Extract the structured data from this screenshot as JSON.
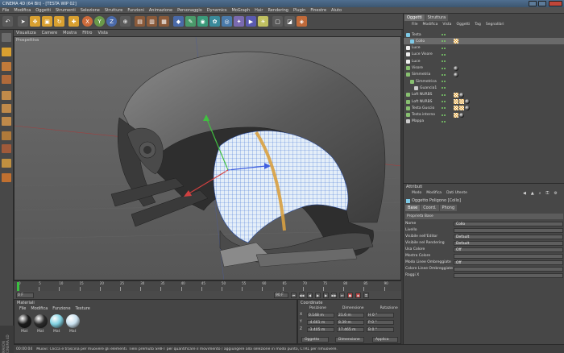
{
  "window": {
    "title": "CINEMA 4D (64 Bit) - [TESTA WIP 02]"
  },
  "menu": [
    "File",
    "Modifica",
    "Oggetti",
    "Strumenti",
    "Selezione",
    "Strutture",
    "Funzioni",
    "Animazione",
    "Personaggio",
    "Dynamics",
    "MoGraph",
    "Hair",
    "Rendering",
    "Plugin",
    "Finestre",
    "Aiuto"
  ],
  "viewport_menu": [
    "Visualizza",
    "Camere",
    "Mostra",
    "Filtro",
    "Vista"
  ],
  "viewport": {
    "label": "Prospettiva"
  },
  "objects_panel": {
    "tabs": [
      "Oggetti",
      "Struttura"
    ],
    "menu": [
      "File",
      "Modifica",
      "Vista",
      "Oggetti",
      "Tag",
      "Segnalibri"
    ],
    "items": [
      {
        "name": "Testa",
        "indent": 0,
        "color": "#7ec9e6"
      },
      {
        "name": "Collo",
        "indent": 1,
        "color": "#7ec9e6",
        "selected": true
      },
      {
        "name": "Luce",
        "indent": 0,
        "color": "#eeeeee"
      },
      {
        "name": "Luce Visore",
        "indent": 0,
        "color": "#eeeeee"
      },
      {
        "name": "Luce",
        "indent": 0,
        "color": "#eeeeee"
      },
      {
        "name": "Visore",
        "indent": 0,
        "color": "#88c070"
      },
      {
        "name": "Simmetria",
        "indent": 0,
        "color": "#88c070"
      },
      {
        "name": "Simmetrica",
        "indent": 1,
        "color": "#88c070"
      },
      {
        "name": "Guancia1",
        "indent": 2,
        "color": "#cccccc"
      },
      {
        "name": "Loft NURBS",
        "indent": 0,
        "color": "#88c070"
      },
      {
        "name": "Loft NURBS",
        "indent": 0,
        "color": "#88c070"
      },
      {
        "name": "Testa Guscio",
        "indent": 0,
        "color": "#88c070"
      },
      {
        "name": "Testa interno",
        "indent": 0,
        "color": "#88c070"
      },
      {
        "name": "Mappa",
        "indent": 0,
        "color": "#cccccc"
      }
    ]
  },
  "attributes_panel": {
    "title": "Attributi",
    "menu": [
      "Modo",
      "Modifica",
      "Dati Utente"
    ],
    "object_title": "Oggetto Poligono [Collo]",
    "tabs": [
      "Base",
      "Coord.",
      "Phong"
    ],
    "section": "Proprietà Base",
    "rows": [
      {
        "label": "Nome",
        "value": "Collo"
      },
      {
        "label": "Livello",
        "value": ""
      },
      {
        "label": "Visibile nell'Editor",
        "value": "Default"
      },
      {
        "label": "Visibile nel Rendering",
        "value": "Default"
      },
      {
        "label": "Usa Colore",
        "value": "Off"
      },
      {
        "label": "Mostra Colore",
        "value": ""
      },
      {
        "label": "Modo Linee Ombreggiate",
        "value": "Off"
      },
      {
        "label": "Colore Linee Ombreggiate",
        "value": ""
      },
      {
        "label": "Raggi X",
        "value": ""
      }
    ]
  },
  "timeline": {
    "ticks": [
      "0",
      "5",
      "10",
      "15",
      "20",
      "25",
      "30",
      "35",
      "40",
      "45",
      "50",
      "55",
      "60",
      "65",
      "70",
      "75",
      "80",
      "85",
      "90"
    ],
    "frame_start": "0 F",
    "frame_end": "90 F",
    "current": "0 F"
  },
  "materials_panel": {
    "title": "Materiali",
    "menu": [
      "File",
      "Modifica",
      "Funzione",
      "Texture"
    ],
    "materials": [
      {
        "name": "Mat",
        "color": "#1a1a1a"
      },
      {
        "name": "Mat",
        "color": "#2a2a2a"
      },
      {
        "name": "Mat",
        "color": "#7fd0e0"
      },
      {
        "name": "Mat",
        "color": "#c8e0ee"
      }
    ]
  },
  "coords_panel": {
    "title": "Coordinate",
    "headers": [
      "Posizione",
      "Dimensione",
      "Rotazione"
    ],
    "rows": [
      {
        "axis": "X",
        "pos": "0.148 m",
        "dim": "21.6 m",
        "rot": "H",
        "rotv": "0 °"
      },
      {
        "axis": "Y",
        "pos": "-4.661 m",
        "dim": "8.39 m",
        "rot": "P",
        "rotv": "0 °"
      },
      {
        "axis": "Z",
        "pos": "-3.405 m",
        "dim": "17.465 m",
        "rot": "B",
        "rotv": "0 °"
      }
    ],
    "mode_select": "Oggetto",
    "size_select": "Dimensione",
    "apply_label": "Applica"
  },
  "status": {
    "time": "00:00:04",
    "text": "Muovi: Clicca e trascina per muovere gli elementi. Tieni premuto SHIFT per quantificare il movimento / aggiungere alla selezione in modo punto, CTRL per rimuovere."
  },
  "brand": "MAXON CINEMA 4D"
}
